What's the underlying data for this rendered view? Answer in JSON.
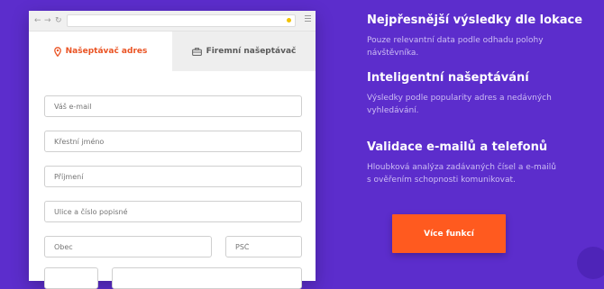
{
  "browser": {
    "tabs": [
      {
        "label": "Našeptávač adres",
        "icon": "map-pin-icon",
        "active": true
      },
      {
        "label": "Firemní našeptávač",
        "icon": "briefcase-icon",
        "active": false
      }
    ],
    "form": {
      "email_placeholder": "Váš e-mail",
      "first_name_placeholder": "Křestní jméno",
      "last_name_placeholder": "Příjmení",
      "street_placeholder": "Ulice a číslo popisné",
      "city_placeholder": "Obec",
      "zip_placeholder": "PSČ"
    }
  },
  "features": [
    {
      "title": "Nejpřesnější výsledky dle lokace",
      "description": "Pouze relevantní data podle odhadu polohy návštěvníka."
    },
    {
      "title": "Inteligentní našeptávání",
      "description": "Výsledky podle popularity adres a nedávných vyhledávání."
    },
    {
      "title": "Validace e-mailů a telefonů",
      "description": "Hloubková analýza zadávaných čísel a e-mailů s ověřením schopnosti komunikovat."
    }
  ],
  "cta": {
    "label": "Více funkcí"
  },
  "colors": {
    "background": "#5c2dcc",
    "accent": "#ff5a1f",
    "active_tab_text": "#ea5323",
    "feature_description": "#cdbdf4"
  }
}
